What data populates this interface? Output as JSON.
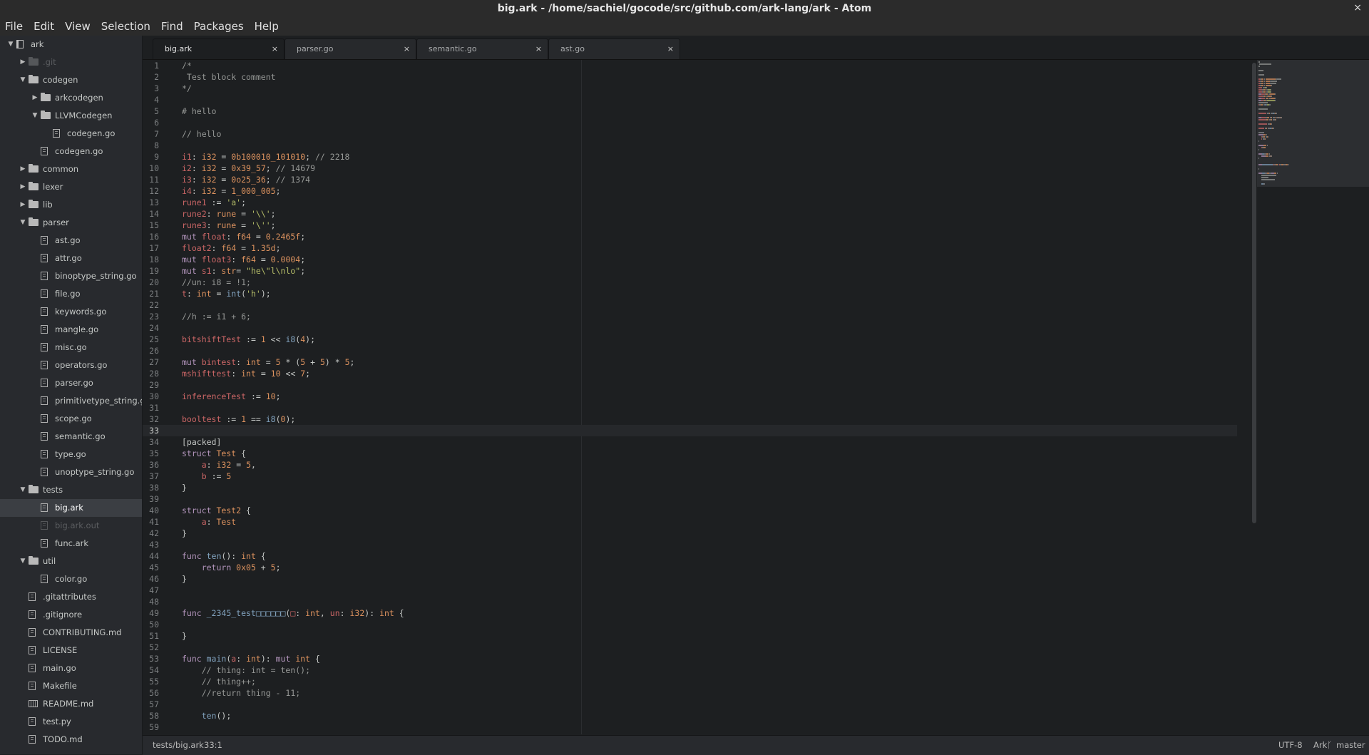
{
  "window": {
    "title": "big.ark - /home/sachiel/gocode/src/github.com/ark-lang/ark - Atom",
    "close": "×"
  },
  "menu": [
    "File",
    "Edit",
    "View",
    "Selection",
    "Find",
    "Packages",
    "Help"
  ],
  "tree": [
    {
      "label": "ark",
      "depth": 0,
      "type": "repo",
      "open": true
    },
    {
      "label": ".git",
      "depth": 1,
      "type": "folder",
      "open": false,
      "ignored": true
    },
    {
      "label": "codegen",
      "depth": 1,
      "type": "folder",
      "open": true
    },
    {
      "label": "arkcodegen",
      "depth": 2,
      "type": "folder",
      "open": false
    },
    {
      "label": "LLVMCodegen",
      "depth": 2,
      "type": "folder",
      "open": true
    },
    {
      "label": "codegen.go",
      "depth": 3,
      "type": "file"
    },
    {
      "label": "codegen.go",
      "depth": 2,
      "type": "file"
    },
    {
      "label": "common",
      "depth": 1,
      "type": "folder",
      "open": false
    },
    {
      "label": "lexer",
      "depth": 1,
      "type": "folder",
      "open": false
    },
    {
      "label": "lib",
      "depth": 1,
      "type": "folder",
      "open": false
    },
    {
      "label": "parser",
      "depth": 1,
      "type": "folder",
      "open": true
    },
    {
      "label": "ast.go",
      "depth": 2,
      "type": "file"
    },
    {
      "label": "attr.go",
      "depth": 2,
      "type": "file"
    },
    {
      "label": "binoptype_string.go",
      "depth": 2,
      "type": "file"
    },
    {
      "label": "file.go",
      "depth": 2,
      "type": "file"
    },
    {
      "label": "keywords.go",
      "depth": 2,
      "type": "file"
    },
    {
      "label": "mangle.go",
      "depth": 2,
      "type": "file"
    },
    {
      "label": "misc.go",
      "depth": 2,
      "type": "file"
    },
    {
      "label": "operators.go",
      "depth": 2,
      "type": "file"
    },
    {
      "label": "parser.go",
      "depth": 2,
      "type": "file"
    },
    {
      "label": "primitivetype_string.go",
      "depth": 2,
      "type": "file"
    },
    {
      "label": "scope.go",
      "depth": 2,
      "type": "file"
    },
    {
      "label": "semantic.go",
      "depth": 2,
      "type": "file"
    },
    {
      "label": "type.go",
      "depth": 2,
      "type": "file"
    },
    {
      "label": "unoptype_string.go",
      "depth": 2,
      "type": "file"
    },
    {
      "label": "tests",
      "depth": 1,
      "type": "folder",
      "open": true
    },
    {
      "label": "big.ark",
      "depth": 2,
      "type": "file",
      "selected": true
    },
    {
      "label": "big.ark.out",
      "depth": 2,
      "type": "file",
      "ignored": true
    },
    {
      "label": "func.ark",
      "depth": 2,
      "type": "file"
    },
    {
      "label": "util",
      "depth": 1,
      "type": "folder",
      "open": true
    },
    {
      "label": "color.go",
      "depth": 2,
      "type": "file"
    },
    {
      "label": ".gitattributes",
      "depth": 1,
      "type": "file"
    },
    {
      "label": ".gitignore",
      "depth": 1,
      "type": "file"
    },
    {
      "label": "CONTRIBUTING.md",
      "depth": 1,
      "type": "file"
    },
    {
      "label": "LICENSE",
      "depth": 1,
      "type": "file"
    },
    {
      "label": "main.go",
      "depth": 1,
      "type": "file"
    },
    {
      "label": "Makefile",
      "depth": 1,
      "type": "file"
    },
    {
      "label": "README.md",
      "depth": 1,
      "type": "readme"
    },
    {
      "label": "test.py",
      "depth": 1,
      "type": "file"
    },
    {
      "label": "TODO.md",
      "depth": 1,
      "type": "file"
    }
  ],
  "tabs": [
    {
      "label": "big.ark",
      "active": true,
      "close": "×"
    },
    {
      "label": "parser.go",
      "active": false,
      "close": "×"
    },
    {
      "label": "semantic.go",
      "active": false,
      "close": "×"
    },
    {
      "label": "ast.go",
      "active": false,
      "close": "×"
    }
  ],
  "editor": {
    "current_line": 33,
    "lines": [
      [
        [
          "c",
          "/*"
        ]
      ],
      [
        [
          "c",
          " Test block comment"
        ]
      ],
      [
        [
          "c",
          "*/"
        ]
      ],
      [],
      [
        [
          "c",
          "# hello"
        ]
      ],
      [],
      [
        [
          "c",
          "// hello"
        ]
      ],
      [],
      [
        [
          "v",
          "i1"
        ],
        [
          "p",
          ": "
        ],
        [
          "t",
          "i32"
        ],
        [
          "p",
          " = "
        ],
        [
          "n",
          "0b100010_101010"
        ],
        [
          "p",
          "; "
        ],
        [
          "c",
          "// 2218"
        ]
      ],
      [
        [
          "v",
          "i2"
        ],
        [
          "p",
          ": "
        ],
        [
          "t",
          "i32"
        ],
        [
          "p",
          " = "
        ],
        [
          "n",
          "0x39_57"
        ],
        [
          "p",
          "; "
        ],
        [
          "c",
          "// 14679"
        ]
      ],
      [
        [
          "v",
          "i3"
        ],
        [
          "p",
          ": "
        ],
        [
          "t",
          "i32"
        ],
        [
          "p",
          " = "
        ],
        [
          "n",
          "0o25_36"
        ],
        [
          "p",
          "; "
        ],
        [
          "c",
          "// 1374"
        ]
      ],
      [
        [
          "v",
          "i4"
        ],
        [
          "p",
          ": "
        ],
        [
          "t",
          "i32"
        ],
        [
          "p",
          " = "
        ],
        [
          "n",
          "1_000_005"
        ],
        [
          "p",
          ";"
        ]
      ],
      [
        [
          "v",
          "rune1"
        ],
        [
          "p",
          " := "
        ],
        [
          "s",
          "'a'"
        ],
        [
          "p",
          ";"
        ]
      ],
      [
        [
          "v",
          "rune2"
        ],
        [
          "p",
          ": "
        ],
        [
          "t",
          "rune"
        ],
        [
          "p",
          " = "
        ],
        [
          "s",
          "'\\\\'"
        ],
        [
          "p",
          ";"
        ]
      ],
      [
        [
          "v",
          "rune3"
        ],
        [
          "p",
          ": "
        ],
        [
          "t",
          "rune"
        ],
        [
          "p",
          " = "
        ],
        [
          "s",
          "'\\''"
        ],
        [
          "p",
          ";"
        ]
      ],
      [
        [
          "k",
          "mut "
        ],
        [
          "v",
          "float"
        ],
        [
          "p",
          ": "
        ],
        [
          "t",
          "f64"
        ],
        [
          "p",
          " = "
        ],
        [
          "n",
          "0.2465f"
        ],
        [
          "p",
          ";"
        ]
      ],
      [
        [
          "v",
          "float2"
        ],
        [
          "p",
          ": "
        ],
        [
          "t",
          "f64"
        ],
        [
          "p",
          " = "
        ],
        [
          "n",
          "1.35d"
        ],
        [
          "p",
          ";"
        ]
      ],
      [
        [
          "k",
          "mut "
        ],
        [
          "v",
          "float3"
        ],
        [
          "p",
          ": "
        ],
        [
          "t",
          "f64"
        ],
        [
          "p",
          " = "
        ],
        [
          "n",
          "0.0004"
        ],
        [
          "p",
          ";"
        ]
      ],
      [
        [
          "k",
          "mut "
        ],
        [
          "v",
          "s1"
        ],
        [
          "p",
          ": "
        ],
        [
          "t",
          "str"
        ],
        [
          "p",
          "= "
        ],
        [
          "s",
          "\"he\\\"l\\nlo\""
        ],
        [
          "p",
          ";"
        ]
      ],
      [
        [
          "c",
          "//un: i8 = !1;"
        ]
      ],
      [
        [
          "v",
          "t"
        ],
        [
          "p",
          ": "
        ],
        [
          "t",
          "int"
        ],
        [
          "p",
          " = "
        ],
        [
          "f",
          "int"
        ],
        [
          "p",
          "("
        ],
        [
          "s",
          "'h'"
        ],
        [
          "p",
          ");"
        ]
      ],
      [],
      [
        [
          "c",
          "//h := i1 + 6;"
        ]
      ],
      [],
      [
        [
          "v",
          "bitshiftTest"
        ],
        [
          "p",
          " := "
        ],
        [
          "n",
          "1"
        ],
        [
          "p",
          " << "
        ],
        [
          "f",
          "i8"
        ],
        [
          "p",
          "("
        ],
        [
          "n",
          "4"
        ],
        [
          "p",
          ");"
        ]
      ],
      [],
      [
        [
          "k",
          "mut "
        ],
        [
          "v",
          "bintest"
        ],
        [
          "p",
          ": "
        ],
        [
          "t",
          "int"
        ],
        [
          "p",
          " = "
        ],
        [
          "n",
          "5"
        ],
        [
          "p",
          " * ("
        ],
        [
          "n",
          "5"
        ],
        [
          "p",
          " + "
        ],
        [
          "n",
          "5"
        ],
        [
          "p",
          ") * "
        ],
        [
          "n",
          "5"
        ],
        [
          "p",
          ";"
        ]
      ],
      [
        [
          "v",
          "mshifttest"
        ],
        [
          "p",
          ": "
        ],
        [
          "t",
          "int"
        ],
        [
          "p",
          " = "
        ],
        [
          "n",
          "10"
        ],
        [
          "p",
          " << "
        ],
        [
          "n",
          "7"
        ],
        [
          "p",
          ";"
        ]
      ],
      [],
      [
        [
          "v",
          "inferenceTest"
        ],
        [
          "p",
          " := "
        ],
        [
          "n",
          "10"
        ],
        [
          "p",
          ";"
        ]
      ],
      [],
      [
        [
          "v",
          "booltest"
        ],
        [
          "p",
          " := "
        ],
        [
          "n",
          "1"
        ],
        [
          "p",
          " == "
        ],
        [
          "f",
          "i8"
        ],
        [
          "p",
          "("
        ],
        [
          "n",
          "0"
        ],
        [
          "p",
          ");"
        ]
      ],
      [],
      [
        [
          "p",
          "[packed]"
        ]
      ],
      [
        [
          "k",
          "struct "
        ],
        [
          "t",
          "Test"
        ],
        [
          "p",
          " {"
        ]
      ],
      [
        [
          "p",
          "    "
        ],
        [
          "v",
          "a"
        ],
        [
          "p",
          ": "
        ],
        [
          "t",
          "i32"
        ],
        [
          "p",
          " = "
        ],
        [
          "n",
          "5"
        ],
        [
          "p",
          ","
        ]
      ],
      [
        [
          "p",
          "    "
        ],
        [
          "v",
          "b"
        ],
        [
          "p",
          " := "
        ],
        [
          "n",
          "5"
        ]
      ],
      [
        [
          "p",
          "}"
        ]
      ],
      [],
      [
        [
          "k",
          "struct "
        ],
        [
          "t",
          "Test2"
        ],
        [
          "p",
          " {"
        ]
      ],
      [
        [
          "p",
          "    "
        ],
        [
          "v",
          "a"
        ],
        [
          "p",
          ": "
        ],
        [
          "t",
          "Test"
        ]
      ],
      [
        [
          "p",
          "}"
        ]
      ],
      [],
      [
        [
          "k",
          "func "
        ],
        [
          "f",
          "ten"
        ],
        [
          "p",
          "(): "
        ],
        [
          "t",
          "int"
        ],
        [
          "p",
          " {"
        ]
      ],
      [
        [
          "p",
          "    "
        ],
        [
          "k",
          "return "
        ],
        [
          "n",
          "0x05"
        ],
        [
          "p",
          " + "
        ],
        [
          "n",
          "5"
        ],
        [
          "p",
          ";"
        ]
      ],
      [
        [
          "p",
          "}"
        ]
      ],
      [],
      [],
      [
        [
          "k",
          "func "
        ],
        [
          "f",
          "_2345_test□□□□□□"
        ],
        [
          "p",
          "("
        ],
        [
          "v",
          "□"
        ],
        [
          "p",
          ": "
        ],
        [
          "t",
          "int"
        ],
        [
          "p",
          ", "
        ],
        [
          "v",
          "un"
        ],
        [
          "p",
          ": "
        ],
        [
          "t",
          "i32"
        ],
        [
          "p",
          "): "
        ],
        [
          "t",
          "int"
        ],
        [
          "p",
          " {"
        ]
      ],
      [],
      [
        [
          "p",
          "}"
        ]
      ],
      [],
      [
        [
          "k",
          "func "
        ],
        [
          "f",
          "main"
        ],
        [
          "p",
          "("
        ],
        [
          "v",
          "a"
        ],
        [
          "p",
          ": "
        ],
        [
          "t",
          "int"
        ],
        [
          "p",
          "): "
        ],
        [
          "k",
          "mut "
        ],
        [
          "t",
          "int"
        ],
        [
          "p",
          " {"
        ]
      ],
      [
        [
          "p",
          "    "
        ],
        [
          "c",
          "// thing: int = ten();"
        ]
      ],
      [
        [
          "p",
          "    "
        ],
        [
          "c",
          "// thing++;"
        ]
      ],
      [
        [
          "p",
          "    "
        ],
        [
          "c",
          "//return thing - 11;"
        ]
      ],
      [],
      [
        [
          "p",
          "    "
        ],
        [
          "f",
          "ten"
        ],
        [
          "p",
          "();"
        ]
      ],
      []
    ]
  },
  "status": {
    "path": "tests/big.ark",
    "cursor": "33:1",
    "encoding": "UTF-8",
    "grammar": "Ark",
    "branch": "master",
    "branch_icon": "git-branch-icon"
  },
  "colors": {
    "comment": "#969896",
    "number": "#de935f",
    "string": "#b5bd68",
    "keyword": "#b294bb",
    "function": "#81a2be",
    "variable": "#cc6666",
    "background": "#1d1f21",
    "sidebar": "#282a2e"
  }
}
